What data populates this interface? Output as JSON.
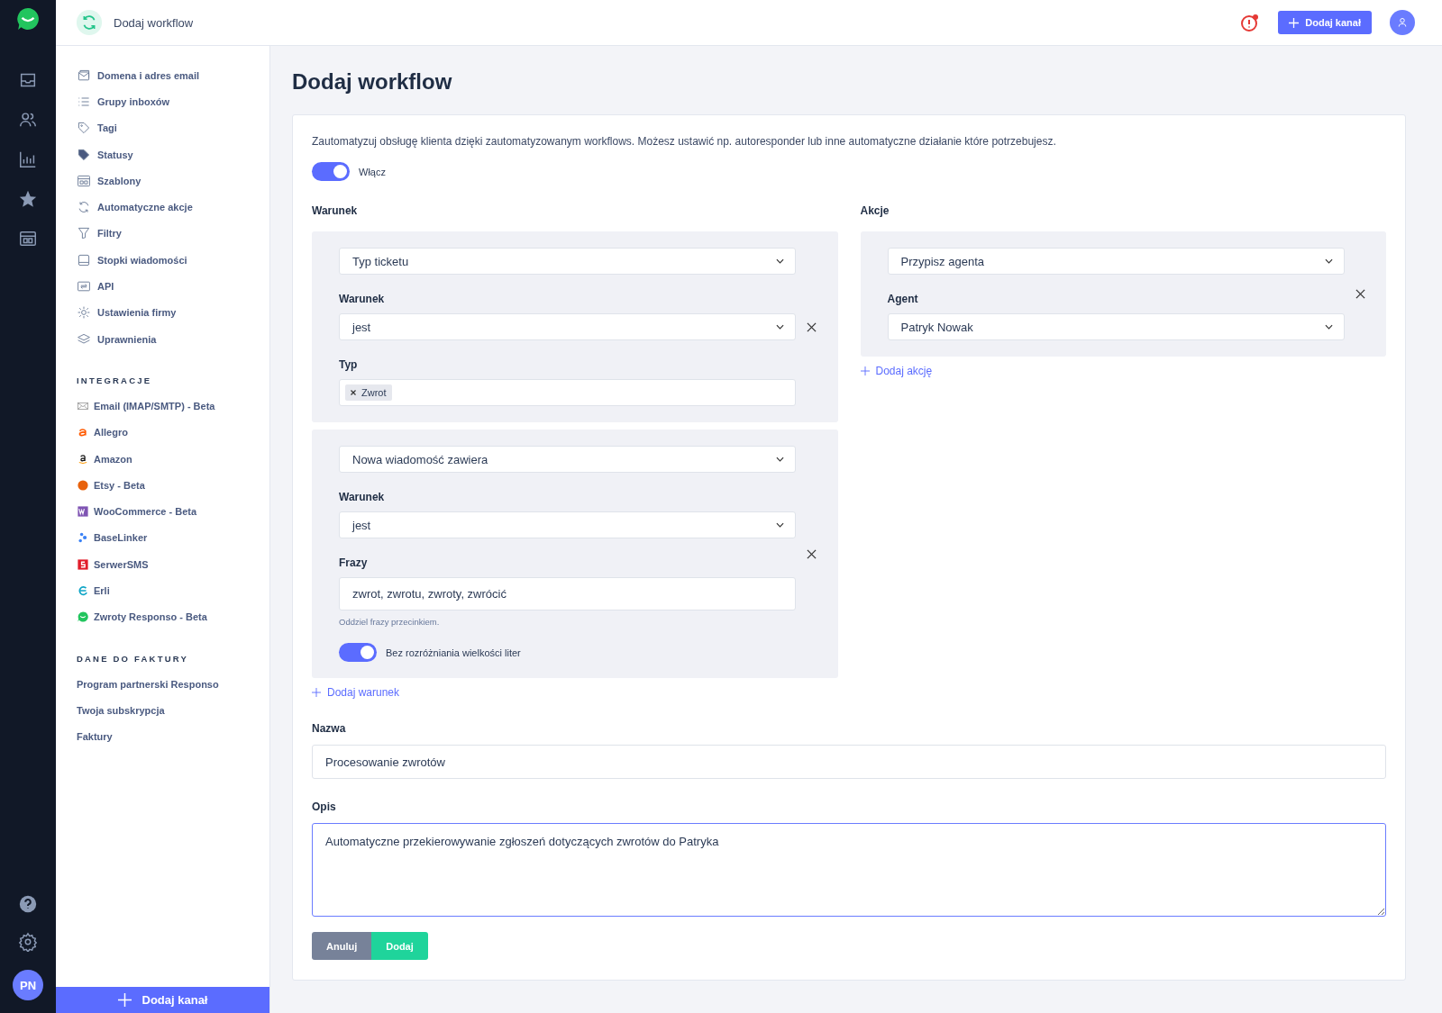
{
  "topbar": {
    "title": "Dodaj workflow",
    "add_channel": "Dodaj kanał"
  },
  "rail": {
    "avatar": "PN"
  },
  "sidebar": {
    "settings": [
      "Domena i adres email",
      "Grupy inboxów",
      "Tagi",
      "Statusy",
      "Szablony",
      "Automatyczne akcje",
      "Filtry",
      "Stopki wiadomości",
      "API",
      "Ustawienia firmy",
      "Uprawnienia"
    ],
    "integrations_heading": "INTEGRACJE",
    "integrations": [
      "Email (IMAP/SMTP) - Beta",
      "Allegro",
      "Amazon",
      "Etsy - Beta",
      "WooCommerce - Beta",
      "BaseLinker",
      "SerwerSMS",
      "Erli",
      "Zwroty Responso - Beta"
    ],
    "billing_heading": "DANE DO FAKTURY",
    "billing": [
      "Program partnerski Responso",
      "Twoja subskrypcja",
      "Faktury"
    ],
    "add_channel": "Dodaj kanał"
  },
  "page": {
    "title": "Dodaj workflow",
    "intro": "Zautomatyzuj obsługę klienta dzięki zautomatyzowanym workflows. Możesz ustawić np. autoresponder lub inne automatyczne działanie które potrzebujesz.",
    "enabled": {
      "label": "Włącz",
      "on": true
    },
    "conditions_heading": "Warunek",
    "conditions": [
      {
        "trigger": "Typ ticketu",
        "operator_label": "Warunek",
        "operator": "jest",
        "value_label": "Typ",
        "kind": "tags",
        "tags": [
          "Zwrot"
        ]
      },
      {
        "trigger": "Nowa wiadomość zawiera",
        "operator_label": "Warunek",
        "operator": "jest",
        "value_label": "Frazy",
        "kind": "text",
        "value": "zwrot, zwrotu, zwroty, zwrócić",
        "hint": "Oddziel frazy przecinkiem.",
        "toggle": {
          "label": "Bez rozróżniania wielkości liter",
          "on": true
        }
      }
    ],
    "add_condition": "Dodaj warunek",
    "actions_heading": "Akcje",
    "actions": [
      {
        "action": "Przypisz agenta",
        "field_label": "Agent",
        "value": "Patryk Nowak"
      }
    ],
    "add_action": "Dodaj akcję",
    "name_label": "Nazwa",
    "name_value": "Procesowanie zwrotów",
    "description_label": "Opis",
    "description_value": "Automatyczne przekierowywanie zgłoszeń dotyczących zwrotów do Patryka",
    "buttons": {
      "cancel": "Anuluj",
      "submit": "Dodaj"
    }
  }
}
